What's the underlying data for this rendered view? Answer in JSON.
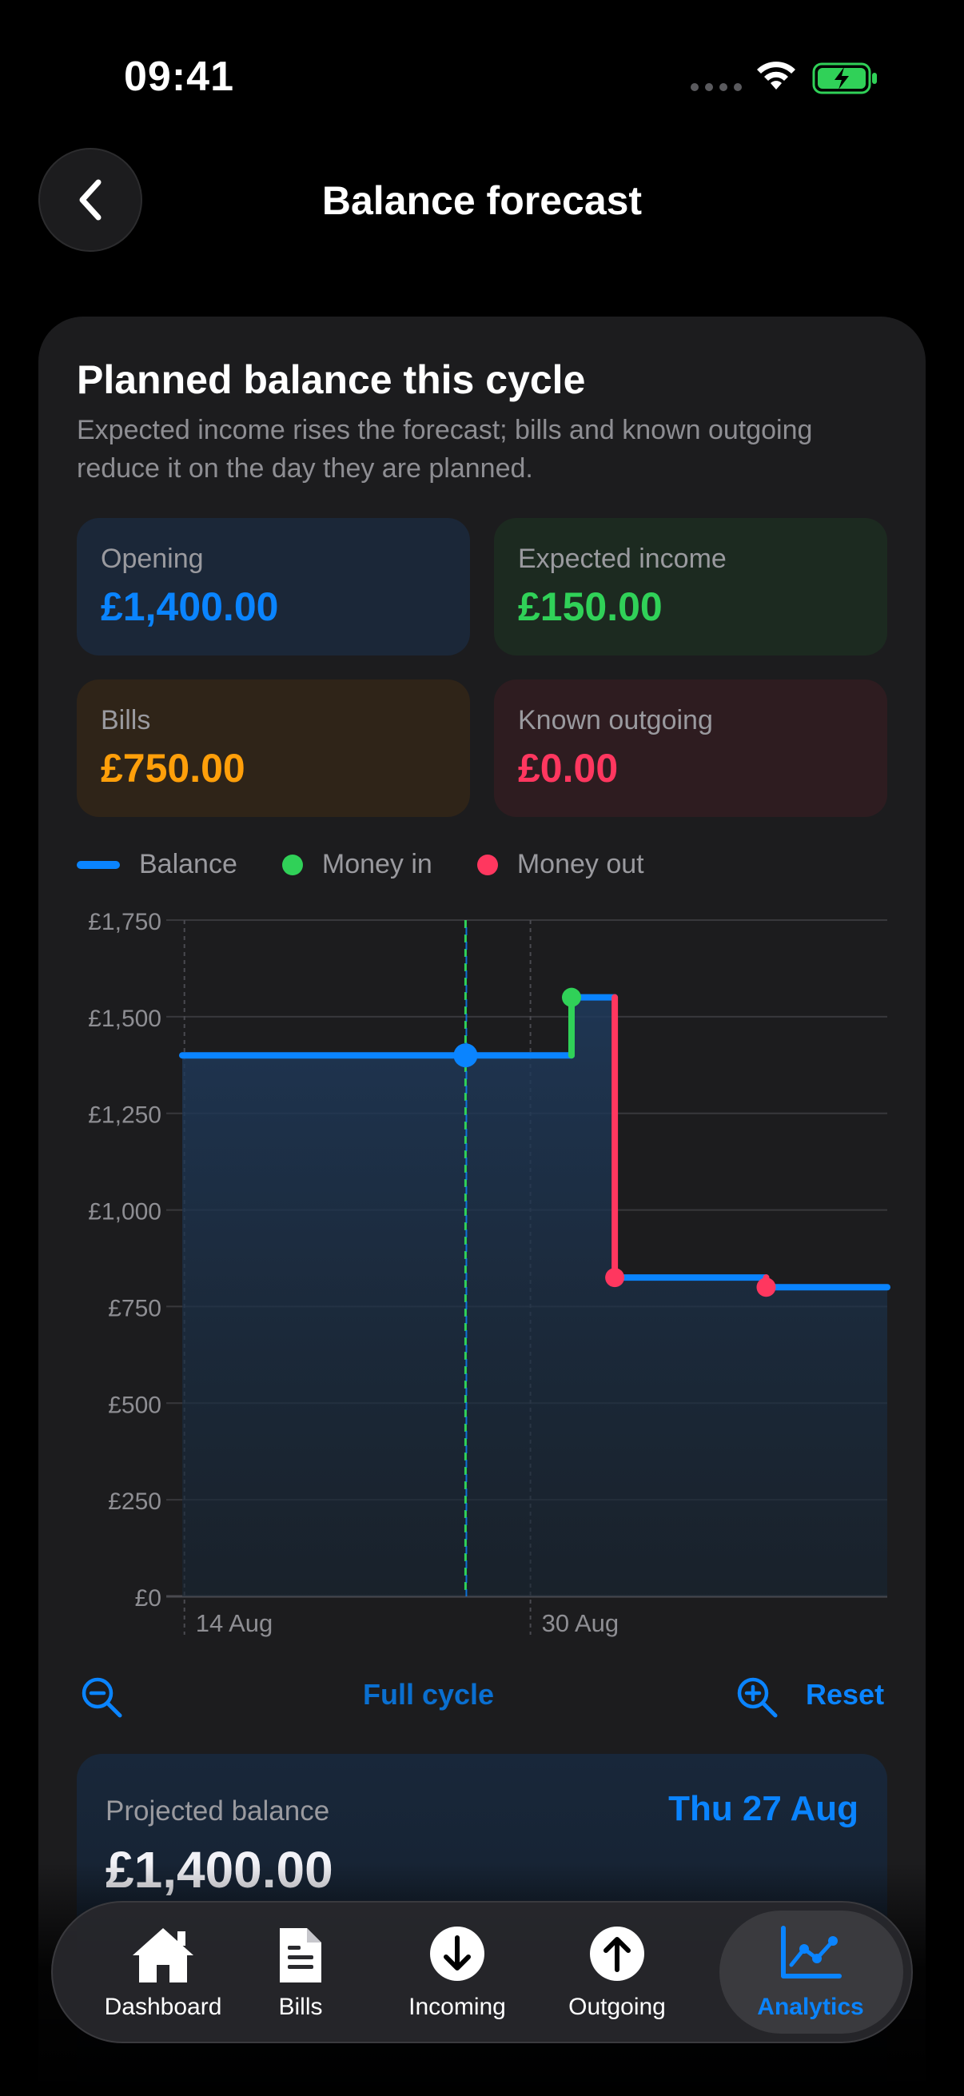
{
  "status_bar": {
    "time": "09:41"
  },
  "header": {
    "title": "Balance forecast"
  },
  "card": {
    "title": "Planned balance this cycle",
    "subtitle": "Expected income rises the forecast; bills and known outgoing reduce it on the day they are planned."
  },
  "stats": {
    "opening": {
      "label": "Opening",
      "value": "£1,400.00"
    },
    "income": {
      "label": "Expected income",
      "value": "£150.00"
    },
    "bills": {
      "label": "Bills",
      "value": "£750.00"
    },
    "outgoing": {
      "label": "Known outgoing",
      "value": "£0.00"
    }
  },
  "legend": {
    "balance": "Balance",
    "money_in": "Money in",
    "money_out": "Money out"
  },
  "colors": {
    "balance": "#0a84ff",
    "money_in": "#30d158",
    "money_out": "#ff375f",
    "bills": "#ff9f0a"
  },
  "chart_data": {
    "type": "line",
    "step": true,
    "y_ticks": [
      "£1,750",
      "£1,500",
      "£1,250",
      "£1,000",
      "£750",
      "£500",
      "£250",
      "£0"
    ],
    "y_tick_values": [
      1750,
      1500,
      1250,
      1000,
      750,
      500,
      250,
      0
    ],
    "ylim": [
      0,
      1750
    ],
    "x_tick_labels": [
      "14 Aug",
      "30 Aug"
    ],
    "x_tick_days": [
      14,
      30
    ],
    "xlim": [
      13.9,
      46.5
    ],
    "series": [
      {
        "name": "Balance",
        "points": [
          {
            "day": 13.9,
            "value": 1400
          },
          {
            "day": 31.9,
            "value": 1400
          },
          {
            "day": 31.9,
            "value": 1550
          },
          {
            "day": 33.9,
            "value": 1550
          },
          {
            "day": 33.9,
            "value": 825
          },
          {
            "day": 40.9,
            "value": 825
          },
          {
            "day": 40.9,
            "value": 800
          },
          {
            "day": 46.5,
            "value": 800
          }
        ]
      }
    ],
    "money_in_events": [
      {
        "day": 31.9,
        "value": 1550
      }
    ],
    "money_out_events": [
      {
        "day": 33.9,
        "value": 825
      },
      {
        "day": 40.9,
        "value": 800
      }
    ],
    "selected": {
      "day": 27,
      "value": 1400
    },
    "grid": true
  },
  "zoom": {
    "full_cycle": "Full cycle",
    "reset": "Reset"
  },
  "projected": {
    "label": "Projected balance",
    "date": "Thu 27 Aug",
    "value": "£1,400.00"
  },
  "tabs": [
    {
      "label": "Dashboard",
      "icon": "house-icon"
    },
    {
      "label": "Bills",
      "icon": "document-icon"
    },
    {
      "label": "Incoming",
      "icon": "arrow-down-circle-icon"
    },
    {
      "label": "Outgoing",
      "icon": "arrow-up-circle-icon"
    },
    {
      "label": "Analytics",
      "icon": "chart-line-icon",
      "active": true
    }
  ]
}
